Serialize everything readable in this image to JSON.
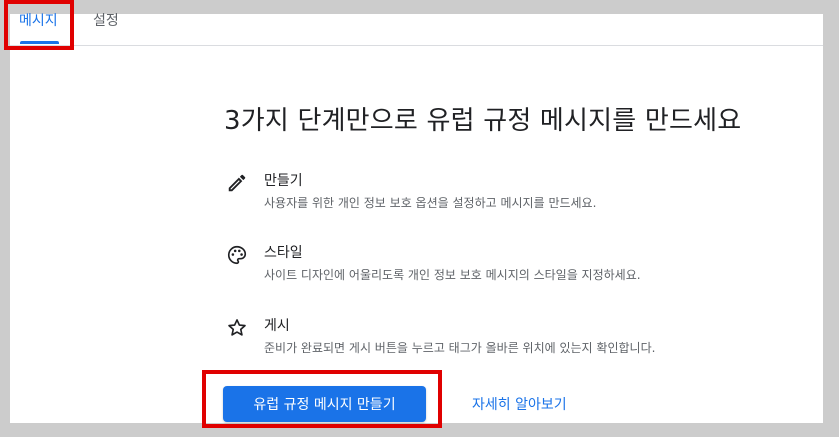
{
  "tabs": [
    {
      "label": "메시지",
      "active": true
    },
    {
      "label": "설정",
      "active": false
    }
  ],
  "hero": {
    "title": "3가지 단계만으로 유럽 규정 메시지를 만드세요"
  },
  "steps": [
    {
      "icon": "pencil-icon",
      "title": "만들기",
      "description": "사용자를 위한 개인 정보 보호 옵션을 설정하고 메시지를 만드세요."
    },
    {
      "icon": "palette-icon",
      "title": "스타일",
      "description": "사이트 디자인에 어울리도록 개인 정보 보호 메시지의 스타일을 지정하세요."
    },
    {
      "icon": "star-icon",
      "title": "게시",
      "description": "준비가 완료되면 게시 버튼을 누르고 태그가 올바른 위치에 있는지 확인합니다."
    }
  ],
  "actions": {
    "primary_label": "유럽 규정 메시지 만들기",
    "learn_more_label": "자세히 알아보기"
  },
  "colors": {
    "accent": "#1a73e8",
    "highlight": "#e00000",
    "background": "#cccccc",
    "panel": "#ffffff"
  }
}
